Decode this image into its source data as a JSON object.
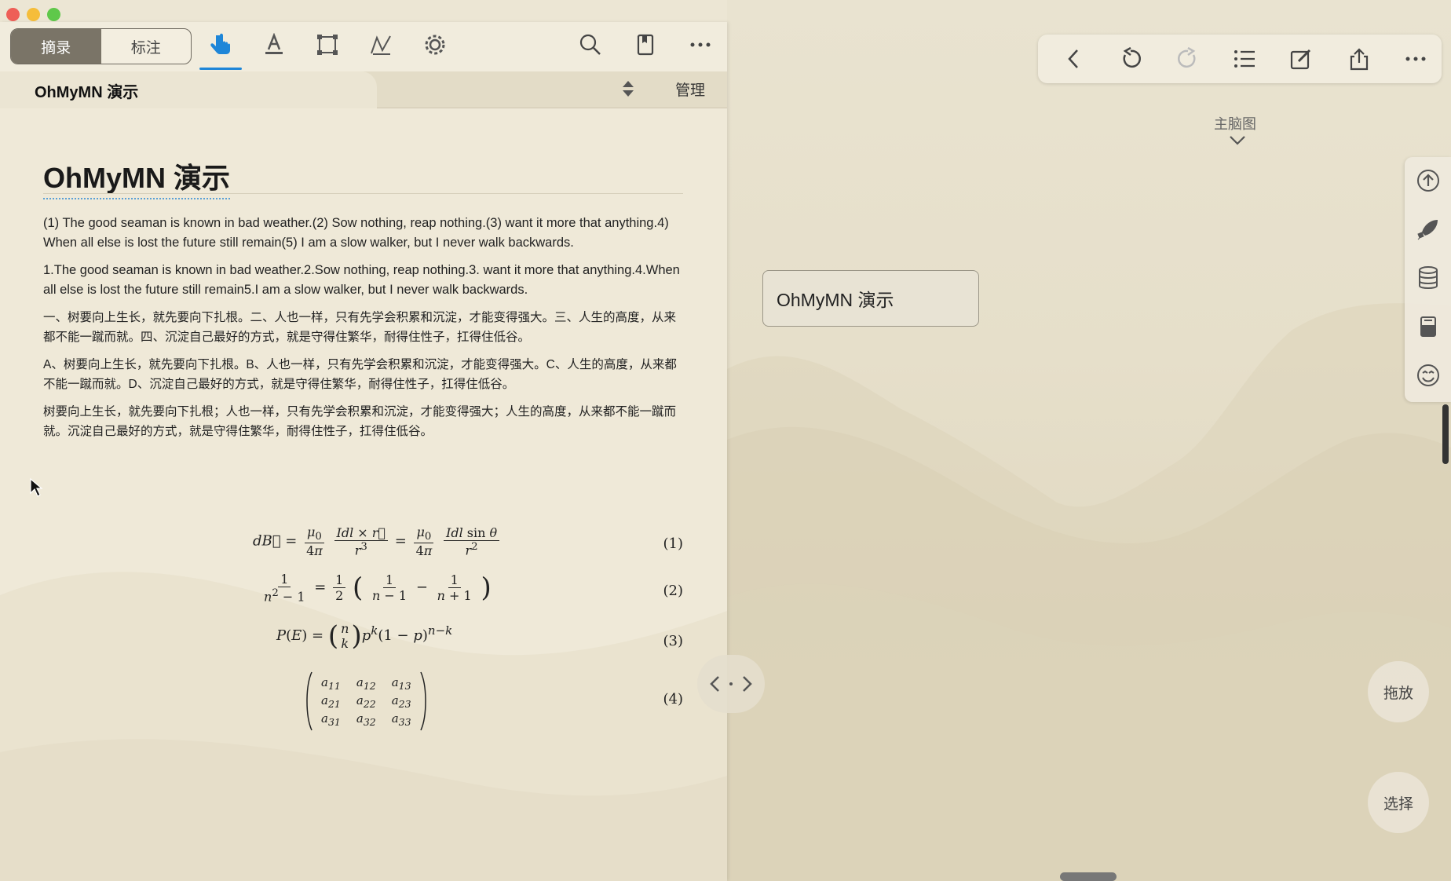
{
  "toolbar": {
    "segment": {
      "excerpt_label": "摘录",
      "annotate_label": "标注",
      "active": "excerpt"
    },
    "tools": [
      "hand-pointer-icon",
      "text-highlight-icon",
      "rectangle-select-icon",
      "freehand-draw-icon",
      "settings-gear-icon"
    ],
    "right_icons": [
      "search-icon",
      "bookmark-icon",
      "more-icon"
    ]
  },
  "doc_tab": {
    "title": "OhMyMN 演示",
    "manage_label": "管理"
  },
  "document": {
    "title": "OhMyMN 演示",
    "paragraphs": [
      "(1) The good seaman is known in bad weather.(2) Sow nothing, reap nothing.(3) want it more that anything.4) When all else is lost the future still remain(5) I am a slow walker, but I never walk backwards.",
      "1.The good seaman is known in bad weather.2.Sow nothing, reap nothing.3. want it more that anything.4.When all else is lost the future still remain5.I am a slow walker, but I never walk backwards.",
      "一、树要向上生长，就先要向下扎根。二、人也一样，只有先学会积累和沉淀，才能变得强大。三、人生的高度，从来都不能一蹴而就。四、沉淀自己最好的方式，就是守得住繁华，耐得住性子，扛得住低谷。",
      "A、树要向上生长，就先要向下扎根。B、人也一样，只有先学会积累和沉淀，才能变得强大。C、人生的高度，从来都不能一蹴而就。D、沉淀自己最好的方式，就是守得住繁华，耐得住性子，扛得住低谷。",
      "树要向上生长，就先要向下扎根；人也一样，只有先学会积累和沉淀，才能变得强大；人生的高度，从来都不能一蹴而就。沉淀自己最好的方式，就是守得住繁华，耐得住性子，扛得住低谷。"
    ],
    "equation_numbers": [
      "(1)",
      "(2)",
      "(3)",
      "(4)"
    ]
  },
  "mindmap": {
    "toolbar_icons": [
      "back-icon",
      "undo-icon",
      "redo-icon",
      "outline-list-icon",
      "edit-icon",
      "share-icon",
      "more-icon"
    ],
    "main_label": "主脑图",
    "node_title": "OhMyMN 演示",
    "side_icons": [
      "upload-icon",
      "rocket-icon",
      "database-icon",
      "notebook-icon",
      "smile-icon"
    ],
    "drag_label": "拖放",
    "select_label": "选择"
  }
}
